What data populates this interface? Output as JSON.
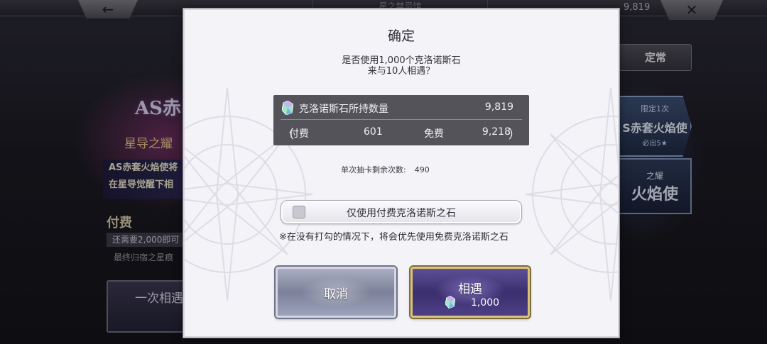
{
  "background": {
    "top_title": "星之禁忌馆",
    "top_count": "9,819",
    "back_icon": "arrow-left",
    "close_icon": "close-x",
    "as_title": "AS赤",
    "star_sub": "星导之耀",
    "band_line1": "AS赤套火焰使将",
    "band_line2": "在星导觉醒下相",
    "paid_label": "付费",
    "need_text": "还需要2,000即可",
    "final_text": "最终归宿之星痕",
    "once_label": "一次相遇",
    "right_tab": "定常",
    "right_banner1_limit": "限定1次",
    "right_banner1_name": "S赤套火焰使",
    "right_banner1_sub": "必出5★",
    "right_banner2_a": "之耀",
    "right_banner2_b": "火焰使"
  },
  "dialog": {
    "title": "确定",
    "question_line1": "是否使用1,000个克洛诺斯石",
    "question_line2": "来与10人相遇？",
    "stone_label": "克洛诺斯石所持数量",
    "stone_total": "9,819",
    "paren_open": "（",
    "paren_close": "）",
    "paid_label": "付费",
    "paid_value": "601",
    "free_label": "免费",
    "free_value": "9,218",
    "remaining_label": "单次抽卡剩余次数:",
    "remaining_value": "490",
    "paid_only_label": "仅使用付费克洛诺斯之石",
    "paid_only_checked": false,
    "note": "※在没有打勾的情况下，将会优先使用免费克洛诺斯之石",
    "cancel_label": "取消",
    "meet_label": "相遇",
    "meet_cost": "1,000"
  },
  "colors": {
    "dialog_bg": "#f4f3f7",
    "panel_bg": "#545359",
    "meet_border": "#d9c27a",
    "cancel_bg": "#8a8fa8"
  }
}
